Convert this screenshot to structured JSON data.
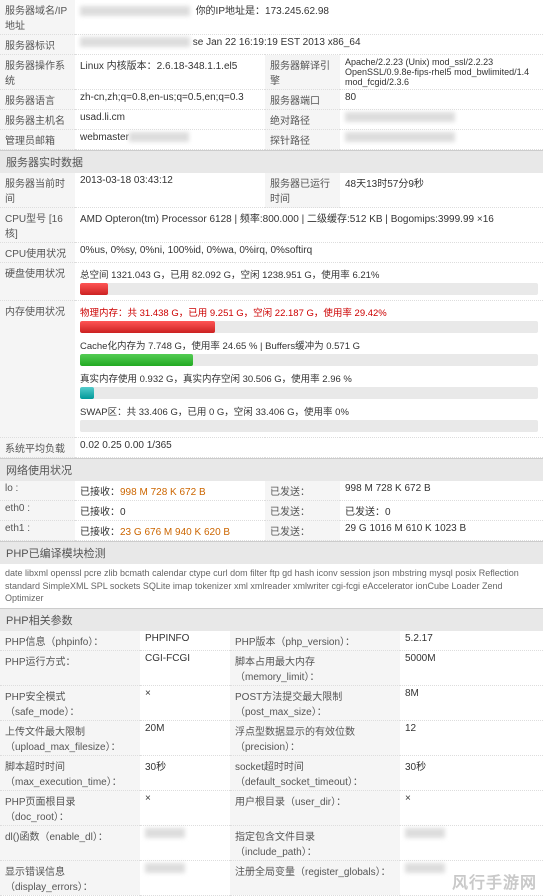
{
  "top": {
    "l0_lbl": "服务器域名/IP地址",
    "l0_val_suffix": "你的IP地址是：173.245.62.98",
    "l1_lbl": "服务器标识",
    "l1_val": "se Jan 22 16:19:19 EST 2013 x86_64",
    "os_lbl": "服务器操作系统",
    "os_val": "Linux  内核版本：2.6.18-348.1.1.el5",
    "srv_lbl": "服务器解译引擎",
    "srv_val": "Apache/2.2.23 (Unix) mod_ssl/2.2.23 OpenSSL/0.9.8e-fips-rhel5 mod_bwlimited/1.4 mod_fcgid/2.3.6",
    "lang_lbl": "服务器语言",
    "lang_val": "zh-cn,zh;q=0.8,en-us;q=0.5,en;q=0.3",
    "port_lbl": "服务器端口",
    "port_val": "80",
    "host_lbl": "服务器主机名",
    "host_val": "usad.li.cm",
    "abs_lbl": "绝对路径",
    "admin_lbl": "管理员邮箱",
    "admin_val": "webmaster",
    "probe_lbl": "探针路径"
  },
  "realtime": {
    "header": "服务器实时数据",
    "time_lbl": "服务器当前时间",
    "time_val": "2013-03-18 03:43:12",
    "uptime_lbl": "服务器已运行时间",
    "uptime_val": "48天13时57分9秒",
    "cpu_lbl": "CPU型号 [16核]",
    "cpu_val": "AMD Opteron(tm) Processor 6128 | 频率:800.000 | 二级缓存:512 KB | Bogomips:3999.99 ×16",
    "cpuuse_lbl": "CPU使用状况",
    "cpuuse_val": "0%us, 0%sy, 0%ni, 100%id, 0%wa, 0%irq, 0%softirq",
    "disk_lbl": "硬盘使用状况",
    "disk_val": "总空间 1321.043 G，已用 82.092 G，空闲 1238.951 G，使用率 6.21%",
    "mem_lbl": "内存使用状况",
    "mem1": "物理内存：共 31.438 G，已用 9.251 G，空闲 22.187 G，使用率 29.42%",
    "mem2": "Cache化内存为 7.748 G，使用率 24.65 % | Buffers缓冲为 0.571 G",
    "mem3": "真实内存使用 0.932 G，真实内存空闲 30.506 G，使用率 2.96 %",
    "mem4": "SWAP区：共 33.406 G，已用 0 G，空闲 33.406 G，使用率 0%",
    "load_lbl": "系统平均负载",
    "load_val": "0.02 0.25 0.00 1/365"
  },
  "net": {
    "header": "网络使用状况",
    "lo_lbl": "lo :",
    "rx_lbl": "已接收：",
    "tx_lbl": "已发送：",
    "lo_rx": "998 M  728 K  672 B",
    "lo_tx": "998 M  728 K  672 B",
    "eth0_lbl": "eth0 :",
    "eth0_rx": "已接收：0",
    "eth0_tx": "已发送：0",
    "eth1_lbl": "eth1 :",
    "eth1_rx": "23 G  676 M  940 K  620 B",
    "eth1_tx": "29 G 1016 M  610 K 1023 B"
  },
  "phpmod": {
    "header": "PHP已编译模块检测",
    "mods": "date  libxml  openssl  pcre  zlib  bcmath  calendar  ctype  curl  dom  filter  ftp  gd  hash  iconv  session  json  mbstring  mysql  posix  Reflection  standard  SimpleXML  SPL  sockets  SQLite  imap  tokenizer  xml  xmlreader  xmlwriter  cgi-fcgi  eAccelerator  ionCube Loader  Zend Optimizer"
  },
  "phpparam": {
    "header": "PHP相关参数",
    "r1a_lbl": "PHP信息（phpinfo）：",
    "r1b_lbl": "PHPINFO",
    "r1c_lbl": "PHP版本（php_version）：",
    "r1c_val": "5.2.17",
    "r2a_lbl": "PHP运行方式：",
    "r2a_val": "CGI-FCGI",
    "r2c_lbl": "脚本占用最大内存（memory_limit）：",
    "r2c_val": "5000M",
    "r3a_lbl": "PHP安全模式（safe_mode）：",
    "r3a_val": "×",
    "r3c_lbl": "POST方法提交最大限制（post_max_size）：",
    "r3c_val": "8M",
    "r4a_lbl": "上传文件最大限制（upload_max_filesize）：",
    "r4a_val": "20M",
    "r4c_lbl": "浮点型数据显示的有效位数（precision）：",
    "r4c_val": "12",
    "r5a_lbl": "脚本超时时间（max_execution_time）：",
    "r5a_val": "30秒",
    "r5c_lbl": "socket超时时间（default_socket_timeout）：",
    "r5c_val": "30秒",
    "r6a_lbl": "PHP页面根目录（doc_root）：",
    "r6a_val": "×",
    "r6c_lbl": "用户根目录（user_dir）：",
    "r6c_val": "×",
    "r7a_lbl": "dl()函数（enable_dl）：",
    "r7c_lbl": "指定包含文件目录（include_path）：",
    "r8a_lbl": "显示错误信息（display_errors）：",
    "r8c_lbl": "注册全局变量（register_globals）："
  },
  "watermark": "风行手游网"
}
